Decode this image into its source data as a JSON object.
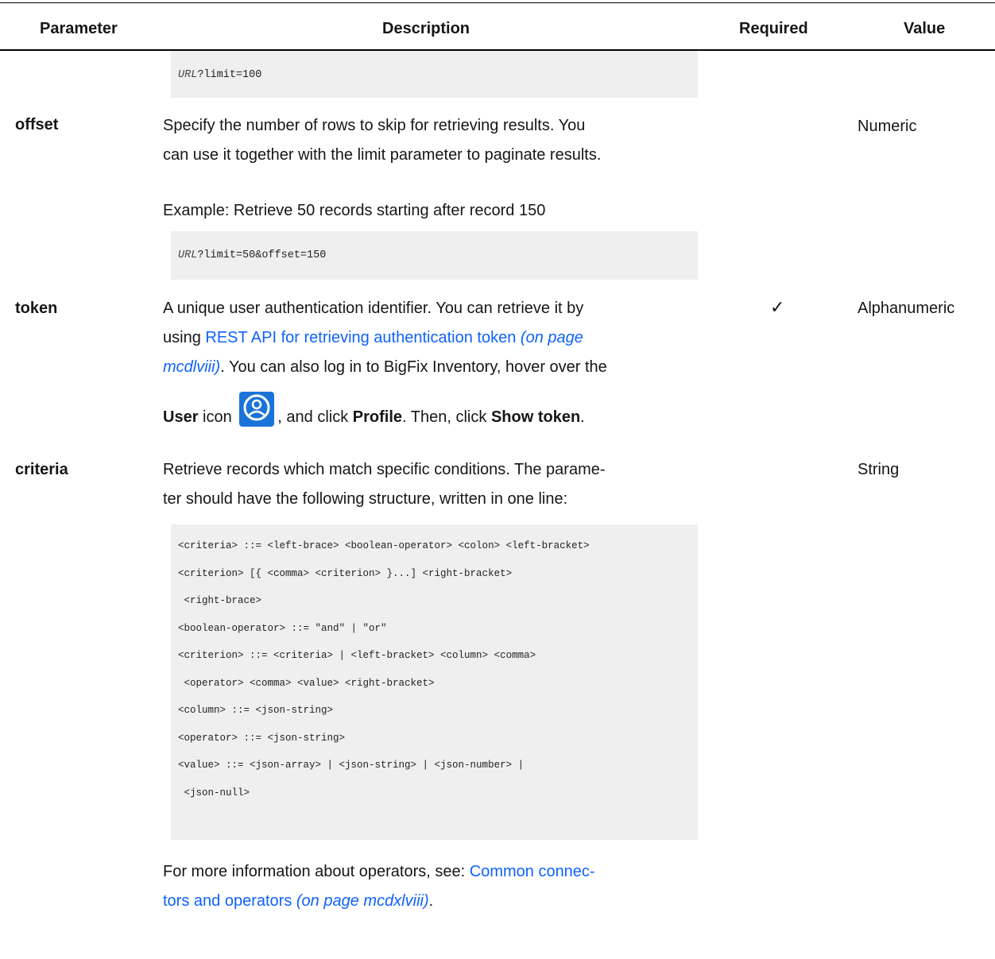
{
  "table": {
    "headers": {
      "parameter": "Parameter",
      "description": "Description",
      "required": "Required",
      "value": "Value"
    }
  },
  "limit_row": {
    "code_url": "URL",
    "code_rest": "?limit=100"
  },
  "offset_row": {
    "name": "offset",
    "description": "Specify the number of rows to skip for retrieving results. You can use it together with the limit parameter to paginate results.",
    "desc_line1": "Specify the number of rows to skip for retrieving results. You",
    "desc_line2": "can use it together with the limit parameter to paginate results.",
    "example": "Example: Retrieve 50 records starting after record 150",
    "code_url": "URL",
    "code_rest": "?limit=50&offset=150",
    "value": "Numeric"
  },
  "token_row": {
    "name": "token",
    "line1": "A unique user authentication identifier. You can retrieve it by",
    "line2_prefix": "using ",
    "link_text": "REST API for retrieving authentication token",
    "link_page_1": "(on page",
    "link_page_2": "mcdlviii)",
    "line3_rest": ". You can also log in to BigFix Inventory, hover over the",
    "user_label": "User",
    "icon_word": " icon ",
    "and_click": ", and click ",
    "profile_label": "Profile",
    "then_click": ". Then, click ",
    "show_token": "Show token",
    "period": ".",
    "required": "✓",
    "value": "Alphanumeric",
    "icon": "user-profile-icon"
  },
  "criteria_row": {
    "name": "criteria",
    "line1": "Retrieve records which match specific conditions. The parame-",
    "line2": "ter should have the following structure, written in one line:",
    "code_lines": [
      "<criteria> ::= <left-brace> <boolean-operator> <colon> <left-bracket>",
      "<criterion> [{ <comma> <criterion> }...] <right-bracket>",
      " <right-brace>",
      "<boolean-operator> ::= \"and\" | \"or\"",
      "<criterion> ::= <criteria> | <left-bracket> <column> <comma>",
      " <operator> <comma> <value> <right-bracket>",
      "<column> ::= <json-string>",
      "<operator> ::= <json-string>",
      "<value> ::= <json-array> | <json-string> | <json-number> |",
      " <json-null>"
    ],
    "more_prefix": "For more information about operators, see: ",
    "more_link_1": "Common connec-",
    "more_link_2": "tors and operators",
    "more_page": "(on page mcdxlviii)",
    "more_period": ".",
    "value": "String"
  },
  "colors": {
    "link": "#0f62fe",
    "code_bg": "#efefef",
    "text": "#161616",
    "icon": "#1a73d9"
  }
}
